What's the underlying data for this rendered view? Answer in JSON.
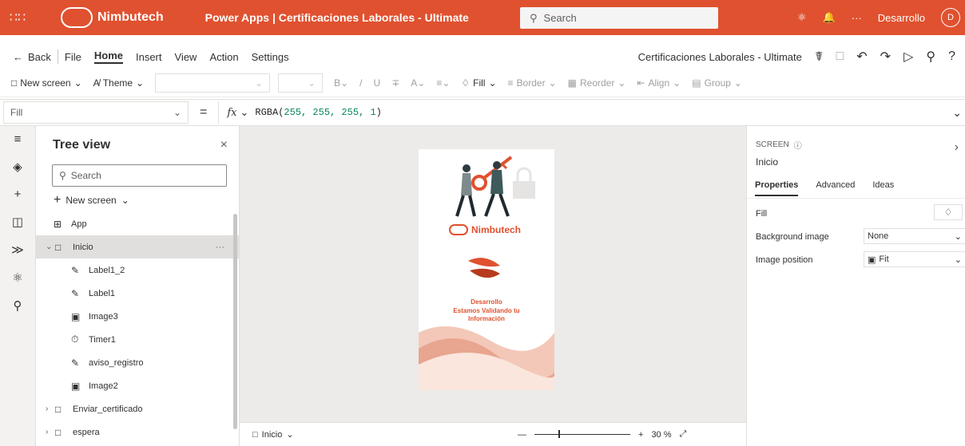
{
  "topbar": {
    "brand_name": "Nimbutech",
    "app_title": "Power Apps | Certificaciones Laborales - Ultimate",
    "search_placeholder": "Search",
    "user_name": "Desarrollo",
    "avatar_initial": "D",
    "more_label": "···",
    "accent_color": "#e0512f"
  },
  "menubar": {
    "back_label": "Back",
    "items": [
      "File",
      "Home",
      "Insert",
      "View",
      "Action",
      "Settings"
    ],
    "active": "Home",
    "app_name": "Certificaciones Laborales - Ultimate"
  },
  "ribbon": {
    "new_screen_label": "New screen",
    "theme_label": "Theme",
    "fill_label": "Fill",
    "border_label": "Border",
    "reorder_label": "Reorder",
    "align_label": "Align",
    "group_label": "Group"
  },
  "formula": {
    "property": "Fill",
    "equals": "=",
    "fx": "fx",
    "expr_fn": "RGBA(",
    "expr_args": "255, 255, 255, 1",
    "expr_end": ")"
  },
  "tree": {
    "title": "Tree view",
    "search_placeholder": "Search",
    "new_screen_label": "New screen",
    "items": [
      {
        "label": "App",
        "level": 0,
        "icon": "app-icon"
      },
      {
        "label": "Inicio",
        "level": 0,
        "icon": "screen-icon",
        "selected": true,
        "expanded": true
      },
      {
        "label": "Label1_2",
        "level": 1,
        "icon": "label-icon"
      },
      {
        "label": "Label1",
        "level": 1,
        "icon": "label-icon"
      },
      {
        "label": "Image3",
        "level": 1,
        "icon": "image-icon"
      },
      {
        "label": "Timer1",
        "level": 1,
        "icon": "timer-icon"
      },
      {
        "label": "aviso_registro",
        "level": 1,
        "icon": "label-icon"
      },
      {
        "label": "Image2",
        "level": 1,
        "icon": "image-icon"
      },
      {
        "label": "Enviar_certificado",
        "level": 0,
        "icon": "screen-icon",
        "collapsed": true
      },
      {
        "label": "espera",
        "level": 0,
        "icon": "screen-icon",
        "collapsed": true
      }
    ]
  },
  "canvas": {
    "brand": "Nimbutech",
    "line1": "Desarrollo",
    "line2": "Estamos Validando tu",
    "line3": "Información"
  },
  "statusbar": {
    "screen": "Inicio",
    "zoom": "30 %"
  },
  "props": {
    "section_label": "SCREEN",
    "screen_name": "Inicio",
    "tabs": [
      "Properties",
      "Advanced",
      "Ideas"
    ],
    "active_tab": "Properties",
    "fill_label": "Fill",
    "bg_image_label": "Background image",
    "bg_image_value": "None",
    "img_pos_label": "Image position",
    "img_pos_value": "Fit"
  }
}
